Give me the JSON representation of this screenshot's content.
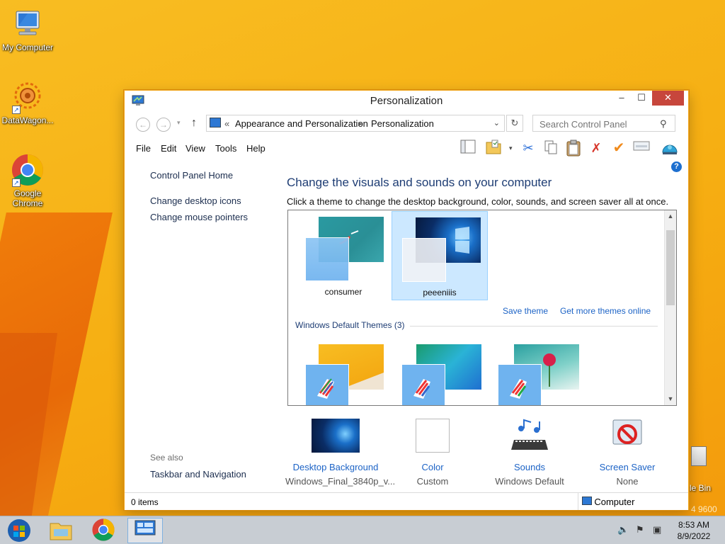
{
  "desktop": {
    "icons": [
      {
        "label": "My Computer"
      },
      {
        "label": "DataWagon..."
      },
      {
        "label": "Google Chrome"
      }
    ],
    "recycle_partial": "cle Bin",
    "watermark_partial": "4 9600"
  },
  "window": {
    "title": "Personalization",
    "controls": {
      "minimize": "–",
      "maximize": "☐",
      "close": "✕"
    },
    "address": {
      "prefix": "«",
      "crumbs": [
        "Appearance and Personalization",
        "Personalization"
      ],
      "separator": "▸"
    },
    "search_placeholder": "Search Control Panel",
    "menu": [
      "File",
      "Edit",
      "View",
      "Tools",
      "Help"
    ],
    "left_pane": {
      "links": [
        "Control Panel Home",
        "Change desktop icons",
        "Change mouse pointers"
      ],
      "see_also_title": "See also",
      "see_also_links": [
        "Taskbar and Navigation"
      ]
    },
    "main": {
      "heading": "Change the visuals and sounds on your computer",
      "subtext": "Click a theme to change the desktop background, color, sounds, and screen saver all at once.",
      "my_themes": [
        {
          "name": "consumer",
          "selected": false
        },
        {
          "name": "peeeniiis",
          "selected": true
        }
      ],
      "save_theme": "Save theme",
      "get_more_themes": "Get more themes online",
      "default_group_title": "Windows Default Themes (3)"
    },
    "bottom": [
      {
        "title": "Desktop Background",
        "subtitle": "Windows_Final_3840p_v..."
      },
      {
        "title": "Color",
        "subtitle": "Custom"
      },
      {
        "title": "Sounds",
        "subtitle": "Windows Default"
      },
      {
        "title": "Screen Saver",
        "subtitle": "None"
      }
    ],
    "status": {
      "items": "0 items",
      "zone": "Computer"
    }
  },
  "taskbar": {
    "time": "8:53 AM",
    "date": "8/9/2022"
  },
  "colors": {
    "accent": "#1e3d74",
    "link": "#1c63c6",
    "close": "#c7463c",
    "desktop": "#f7b213"
  }
}
